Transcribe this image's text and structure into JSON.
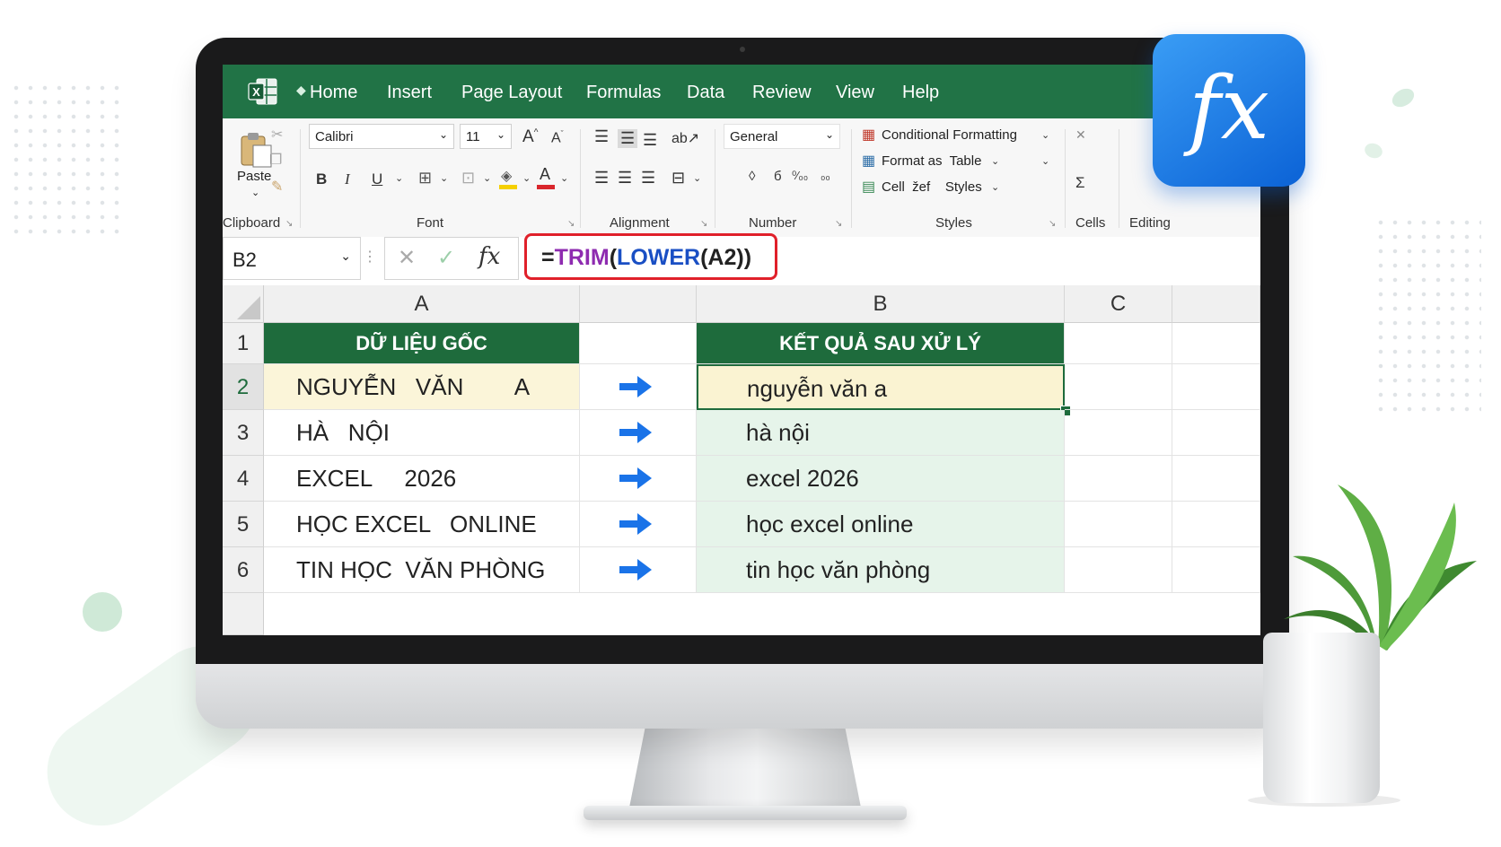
{
  "app": {
    "name": "Excel"
  },
  "menu_tabs": [
    "Home",
    "Insert",
    "Page Layout",
    "Formulas",
    "Data",
    "Review",
    "View",
    "Help"
  ],
  "ribbon": {
    "clipboard": {
      "paste_label": "Paste",
      "group_label": "Clipboard"
    },
    "font": {
      "font_name": "Calibri",
      "font_size": "11",
      "bold": "B",
      "italic": "I",
      "underline": "U",
      "group_label": "Font"
    },
    "alignment": {
      "group_label": "Alignment"
    },
    "number": {
      "format": "General",
      "group_label": "Number"
    },
    "styles": {
      "conditional_formatting": "Conditional Formatting",
      "format_as_table": "Format as  Table",
      "cell_styles": "Cell  žef    Styles",
      "group_label": "Styles"
    },
    "cells": {
      "group_label": "Cells"
    },
    "editing": {
      "group_label": "Editing"
    }
  },
  "formula_bar": {
    "name_box": "B2",
    "formula_parts": {
      "eq": "=",
      "fn1": "TRIM",
      "p1": "(",
      "fn2": "LOWER",
      "rest": "(A2))"
    }
  },
  "sheet": {
    "columns": [
      "A",
      "B",
      "C"
    ],
    "rows": [
      {
        "num": "1",
        "a": "DỮ LIỆU GỐC",
        "b": "KẾT QUẢ SAU XỬ LÝ"
      },
      {
        "num": "2",
        "a": "NGUYỄN   VĂN        A",
        "b": "nguyễn văn a"
      },
      {
        "num": "3",
        "a": "HÀ   NỘI",
        "b": "hà nội"
      },
      {
        "num": "4",
        "a": "EXCEL     2026",
        "b": "excel 2026"
      },
      {
        "num": "5",
        "a": "HỌC EXCEL   ONLINE",
        "b": "học excel online"
      },
      {
        "num": "6",
        "a": "TIN HỌC  VĂN PHÒNG",
        "b": "tin học văn phòng"
      }
    ]
  },
  "badge": {
    "text": "fx"
  },
  "colors": {
    "excel_green": "#217346",
    "header_green": "#1e6b3c",
    "highlight_yellow": "#fbf5d9",
    "result_green": "#e6f4ea",
    "formula_outline": "#e0202a",
    "fx_blue": "#0b62d6",
    "arrow_blue": "#1a73e8"
  }
}
